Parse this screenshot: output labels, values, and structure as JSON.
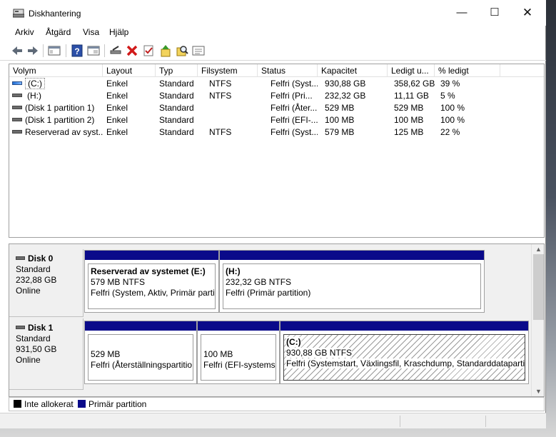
{
  "window": {
    "title": "Diskhantering"
  },
  "menu": [
    "Arkiv",
    "Åtgärd",
    "Visa",
    "Hjälp"
  ],
  "toolbar_icons": [
    "back-arrow-icon",
    "forward-arrow-icon",
    "console-tree-icon",
    "help-icon",
    "properties-icon",
    "connect-icon",
    "delete-icon",
    "check-icon",
    "wizard-icon",
    "search-icon",
    "settings-icon"
  ],
  "columns": [
    "Volym",
    "Layout",
    "Typ",
    "Filsystem",
    "Status",
    "Kapacitet",
    "Ledigt u...",
    "% ledigt"
  ],
  "volumes": [
    {
      "name": "(C:)",
      "layout": "Enkel",
      "type": "Standard",
      "fs": "NTFS",
      "status": "Felfri (Syst...",
      "capacity": "930,88 GB",
      "free": "358,62 GB",
      "pct": "39 %"
    },
    {
      "name": "(H:)",
      "layout": "Enkel",
      "type": "Standard",
      "fs": "NTFS",
      "status": "Felfri (Pri...",
      "capacity": "232,32 GB",
      "free": "11,11 GB",
      "pct": "5 %"
    },
    {
      "name": "(Disk 1 partition 1)",
      "layout": "Enkel",
      "type": "Standard",
      "fs": "",
      "status": "Felfri (Åter...",
      "capacity": "529 MB",
      "free": "529 MB",
      "pct": "100 %"
    },
    {
      "name": "(Disk 1 partition 2)",
      "layout": "Enkel",
      "type": "Standard",
      "fs": "",
      "status": "Felfri (EFI-...",
      "capacity": "100 MB",
      "free": "100 MB",
      "pct": "100 %"
    },
    {
      "name": "Reserverad av syst...",
      "layout": "Enkel",
      "type": "Standard",
      "fs": "NTFS",
      "status": "Felfri (Syst...",
      "capacity": "579 MB",
      "free": "125 MB",
      "pct": "22 %"
    }
  ],
  "disks": [
    {
      "name": "Disk 0",
      "kind": "Standard",
      "size": "232,88 GB",
      "state": "Online",
      "partitions": [
        {
          "name": "Reserverad av systemet  (E:)",
          "size": "579 MB NTFS",
          "status": "Felfri (System, Aktiv, Primär partit"
        },
        {
          "name": "(H:)",
          "size": "232,32 GB NTFS",
          "status": "Felfri (Primär partition)"
        }
      ]
    },
    {
      "name": "Disk 1",
      "kind": "Standard",
      "size": "931,50 GB",
      "state": "Online",
      "partitions": [
        {
          "name": "",
          "size": "529 MB",
          "status": "Felfri (Återställningspartitio"
        },
        {
          "name": "",
          "size": "100 MB",
          "status": "Felfri (EFI-systemsp"
        },
        {
          "name": "(C:)",
          "size": "930,88 GB NTFS",
          "status": "Felfri (Systemstart, Växlingsfil, Kraschdump, Standarddatapartiti"
        }
      ]
    }
  ],
  "legend": {
    "unallocated": "Inte allokerat",
    "unallocated_color": "#000000",
    "primary": "Primär partition",
    "primary_color": "#0a0a8a"
  }
}
